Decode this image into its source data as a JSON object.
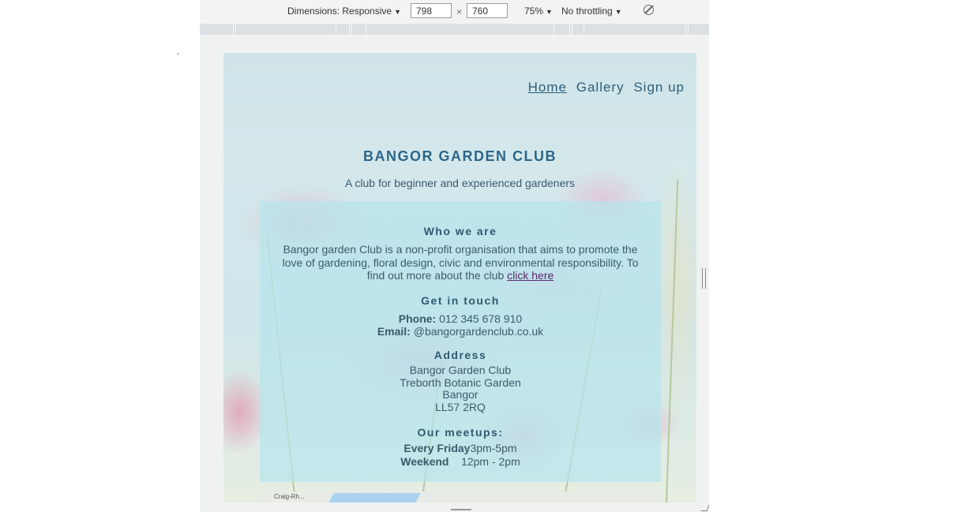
{
  "stray_mark": ".",
  "devtools": {
    "dimensions_label": "Dimensions: Responsive",
    "width_value": "798",
    "times_sign": "×",
    "height_value": "760",
    "zoom": "75%",
    "throttling": "No throttling",
    "caret": "▼",
    "rotate_icon": "rotate-icon"
  },
  "site": {
    "nav": {
      "home": "Home",
      "gallery": "Gallery",
      "signup": "Sign up"
    },
    "title": "BANGOR GARDEN CLUB",
    "tagline": "A club for beginner and experienced gardeners",
    "who": {
      "heading": "Who we are",
      "text": "Bangor garden Club is a non-profit organisation that aims to promote the love of gardening, floral design, civic and environmental responsibility. To find out more about the club",
      "link": "click here"
    },
    "touch": {
      "heading": "Get in touch",
      "phone_label": "Phone:",
      "phone": "012 345 678 910",
      "email_label": "Email:",
      "email": "@bangorgardenclub.co.uk"
    },
    "address": {
      "heading": "Address",
      "line1": "Bangor Garden Club",
      "line2": "Treborth Botanic Garden",
      "line3": "Bangor",
      "line4": "LL57 2RQ"
    },
    "meetups": {
      "heading": "Our meetups:",
      "day1": "Every Friday",
      "time1": "3pm-5pm",
      "day2": "Weekend",
      "time2": "12pm - 2pm"
    },
    "map_label": "Craig-Rh..."
  }
}
